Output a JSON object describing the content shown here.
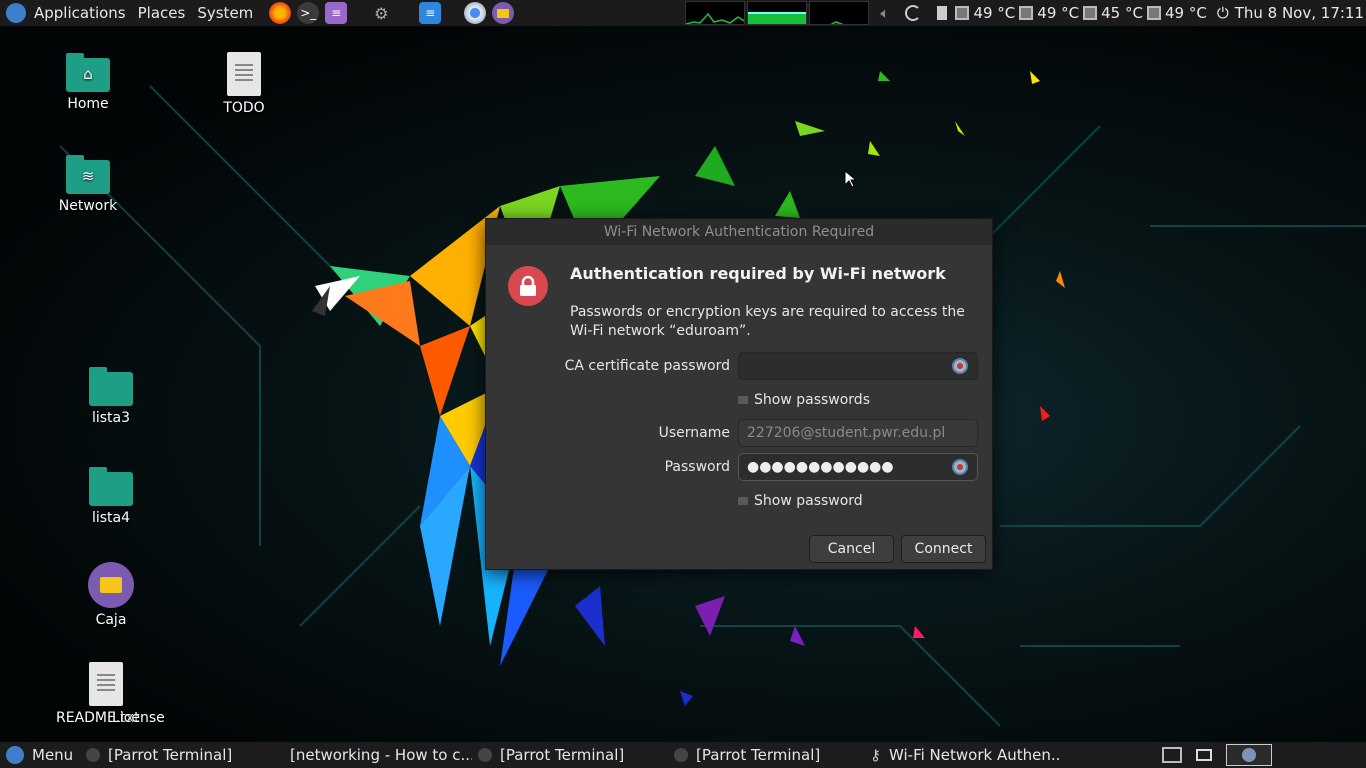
{
  "top_panel": {
    "menus": [
      "Applications",
      "Places",
      "System"
    ],
    "temps": [
      "49 °C",
      "49 °C",
      "45 °C",
      "49 °C"
    ],
    "clock": "Thu  8 Nov, 17:11"
  },
  "desktop_icons": {
    "home": "Home",
    "network": "Network",
    "todo": "TODO",
    "lista3": "lista3",
    "lista4": "lista4",
    "caja": "Caja",
    "readme": "README.txt",
    "license": "License"
  },
  "dialog": {
    "title": "Wi-Fi Network Authentication Required",
    "heading": "Authentication required by Wi-Fi network",
    "message": "Passwords or encryption keys are required to access the Wi-Fi network “eduroam”.",
    "ca_label": "CA certificate password",
    "ca_value": "",
    "show_passwords": "Show passwords",
    "username_label": "Username",
    "username_value": "227206@student.pwr.edu.pl",
    "password_label": "Password",
    "password_value": "●●●●●●●●●●●●",
    "show_password": "Show password",
    "cancel": "Cancel",
    "connect": "Connect"
  },
  "bottom_panel": {
    "menu": "Menu",
    "tasks": [
      "[Parrot Terminal]",
      "[networking - How to c...",
      "[Parrot Terminal]",
      "[Parrot Terminal]",
      "Wi-Fi Network Authen..."
    ]
  },
  "colors": {
    "accent_folder": "#1f9e86",
    "lock_badge": "#d9484f",
    "dialog_bg": "#353535"
  }
}
